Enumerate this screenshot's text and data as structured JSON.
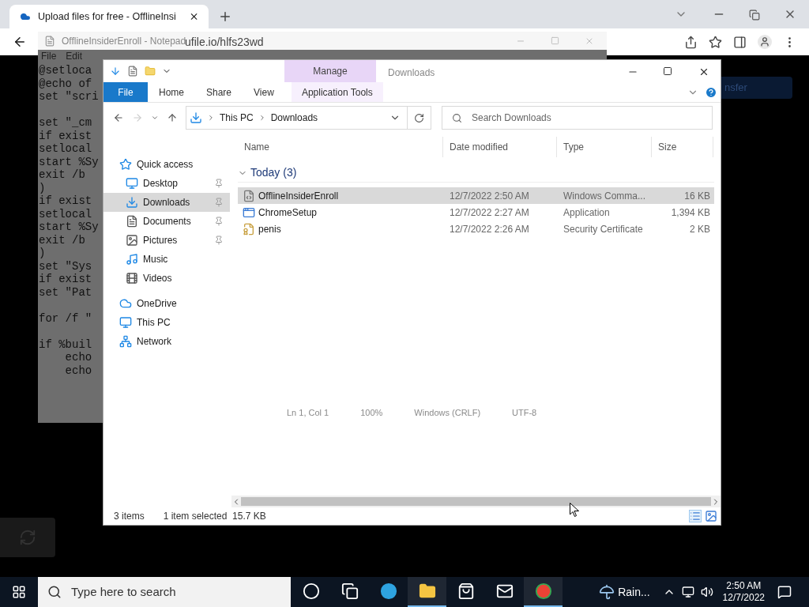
{
  "browser": {
    "tabs": [
      {
        "title": "Upload files for free - OfflineInsi",
        "selected": true
      }
    ],
    "url": "ufile.io/hlfs23wd"
  },
  "page": {
    "button": "nsfer"
  },
  "notepad": {
    "title": "OfflineInsiderEnroll - Notepad",
    "menu": [
      "File",
      "Edit"
    ],
    "blocks": [
      [
        "@setloca",
        "@echo of",
        "set \"scri"
      ],
      [
        "set \"_cm",
        "if exist",
        "setlocal",
        "start %Sy",
        "exit /b",
        ")",
        "if exist",
        "setlocal",
        "start %Sy",
        "exit /b",
        ")",
        "set \"Sys",
        "if exist",
        "set \"Pat"
      ],
      [
        "for /f \""
      ],
      [
        "if %buil",
        "    echo",
        "    echo"
      ]
    ],
    "status": [
      "Ln 1, Col 1",
      "100%",
      "Windows (CRLF)",
      "UTF-8"
    ]
  },
  "explorer": {
    "title": "Downloads",
    "context_tab": "Manage",
    "ribbon_tabs": [
      {
        "label": "File",
        "kind": "file",
        "selected": false
      },
      {
        "label": "Home",
        "kind": "tab",
        "selected": false
      },
      {
        "label": "Share",
        "kind": "tab",
        "selected": false
      },
      {
        "label": "View",
        "kind": "tab",
        "selected": false
      },
      {
        "label": "Application Tools",
        "kind": "context",
        "selected": false
      }
    ],
    "breadcrumb": [
      "This PC",
      "Downloads"
    ],
    "search_placeholder": "Search Downloads",
    "nav": [
      {
        "label": "Quick access",
        "pinned": false,
        "selected": false,
        "children": [
          {
            "label": "Desktop",
            "pinned": true,
            "selected": false
          },
          {
            "label": "Downloads",
            "pinned": true,
            "selected": true
          },
          {
            "label": "Documents",
            "pinned": true,
            "selected": false
          },
          {
            "label": "Pictures",
            "pinned": true,
            "selected": false
          },
          {
            "label": "Music",
            "pinned": false,
            "selected": false
          },
          {
            "label": "Videos",
            "pinned": false,
            "selected": false
          }
        ]
      },
      {
        "label": "OneDrive",
        "pinned": false,
        "selected": false
      },
      {
        "label": "This PC",
        "pinned": false,
        "selected": false
      },
      {
        "label": "Network",
        "pinned": false,
        "selected": false
      }
    ],
    "columns": [
      "Name",
      "Date modified",
      "Type",
      "Size"
    ],
    "group": "Today (3)",
    "files": [
      {
        "name": "OfflineInsiderEnroll",
        "date": "12/7/2022 2:50 AM",
        "type": "Windows Comma...",
        "size": "16 KB",
        "selected": true
      },
      {
        "name": "ChromeSetup",
        "date": "12/7/2022 2:27 AM",
        "type": "Application",
        "size": "1,394 KB",
        "selected": false
      },
      {
        "name": "penis",
        "date": "12/7/2022 2:26 AM",
        "type": "Security Certificate",
        "size": "2 KB",
        "selected": false
      }
    ],
    "status": {
      "count": "3 items",
      "selection": "1 item selected  15.7 KB"
    }
  },
  "taskbar": {
    "search_placeholder": "Type here to search",
    "apps": [
      {
        "kind": "cortana",
        "active": false
      },
      {
        "kind": "taskview",
        "active": false
      },
      {
        "kind": "edge",
        "active": false
      },
      {
        "kind": "explorer",
        "active": true
      },
      {
        "kind": "store",
        "active": false
      },
      {
        "kind": "mail",
        "active": false
      },
      {
        "kind": "chrome",
        "active": true
      }
    ],
    "weather": "Rain...",
    "time": "2:50 AM",
    "date": "12/7/2022"
  }
}
